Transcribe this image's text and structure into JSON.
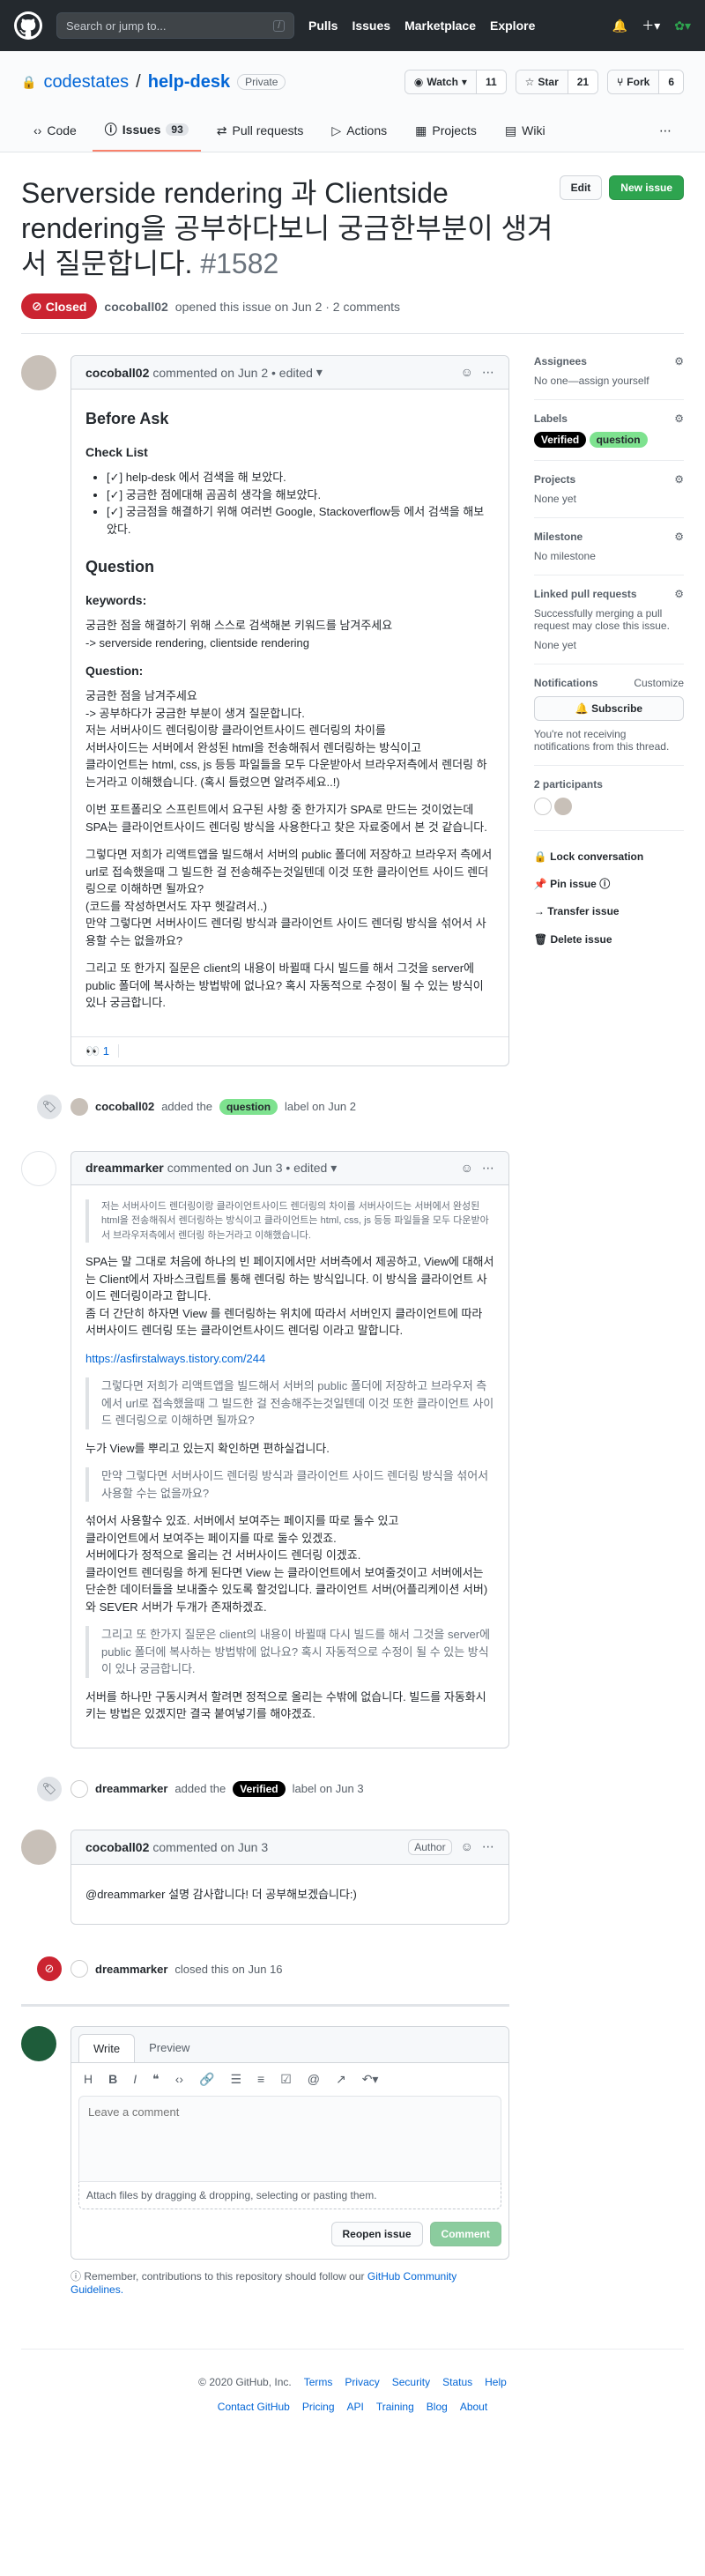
{
  "header": {
    "search_placeholder": "Search or jump to...",
    "slash": "/",
    "nav": [
      "Pulls",
      "Issues",
      "Marketplace",
      "Explore"
    ]
  },
  "repo": {
    "owner": "codestates",
    "name": "help-desk",
    "visibility": "Private",
    "watch": "Watch",
    "watch_count": "11",
    "star": "Star",
    "star_count": "21",
    "fork": "Fork",
    "fork_count": "6"
  },
  "tabs": [
    {
      "label": "Code"
    },
    {
      "label": "Issues",
      "count": "93"
    },
    {
      "label": "Pull requests"
    },
    {
      "label": "Actions"
    },
    {
      "label": "Projects"
    },
    {
      "label": "Wiki"
    }
  ],
  "issue": {
    "title": "Serverside rendering 과 Clientside rendering을 공부하다보니 궁금한부분이 생겨서 질문합니다.",
    "number": "#1582",
    "edit": "Edit",
    "new_issue": "New issue",
    "state": "Closed",
    "author": "cocoball02",
    "meta": "opened this issue on Jun 2 · 2 comments"
  },
  "c1": {
    "author": "cocoball02",
    "meta": "commented on Jun 2 • edited",
    "h_before": "Before Ask",
    "h_check": "Check List",
    "checks": [
      "[✓] help-desk 에서 검색을 해 보았다.",
      "[✓] 궁금한 점에대해 곰곰히 생각을 해보았다.",
      "[✓] 궁금점을 해결하기 위해 여러번 Google, Stackoverflow등 에서 검색을 해보았다."
    ],
    "h_question": "Question",
    "h_keywords": "keywords:",
    "kw": "궁금한 점을 해결하기 위해 스스로 검색해본 키워드를 남겨주세요\n-> serverside rendering, clientside rendering",
    "h_q": "Question:",
    "q1": "궁금한 점을 남겨주세요\n-> 공부하다가 궁금한 부분이 생겨 질문합니다.\n저는 서버사이드 렌더링이랑 클라이언트사이드 렌더링의 차이를\n서버사이드는 서버에서 완성된 html을 전송해줘서 렌더링하는 방식이고\n클라이언트는 html, css, js 등등 파일들을 모두 다운받아서 브라우저측에서 렌더링 하는거라고 이해했습니다. (혹시 틀렸으면 알려주세요..!)",
    "q2": "이번 포트폴리오 스프린트에서 요구된 사항 중 한가지가 SPA로 만드는 것이었는데 SPA는 클라이언트사이드 렌더링 방식을 사용한다고 찾은 자료중에서 본 것 같습니다.",
    "q3": "그렇다면 저희가 리액트앱을 빌드해서 서버의 public 폴더에 저장하고 브라우저 측에서 url로 접속했을때 그 빌드한 걸 전송해주는것일텐데 이것 또한 클라이언트 사이드 렌더링으로 이해하면 될까요?\n(코드를 작성하면서도 자꾸 헷갈려서..)\n만약 그렇다면 서버사이드 렌더링 방식과 클라이언트 사이드 렌더링 방식을 섞어서 사용할 수는 없을까요?",
    "q4": "그리고 또 한가지 질문은 client의 내용이 바뀔때 다시 빌드를 해서 그것을 server에 public 폴더에 복사하는 방법밖에 없나요? 혹시 자동적으로 수정이 될 수 있는 방식이 있나 궁금합니다.",
    "reaction": "👀 1"
  },
  "ev1": {
    "actor": "cocoball02",
    "text": "added the",
    "label": "question",
    "after": "label on Jun 2"
  },
  "c2": {
    "author": "dreammarker",
    "meta": "commented on Jun 3 • edited",
    "quote1": "저는 서버사이드 렌더링이랑 클라이언트사이드 렌더링의 차이를 서버사이드는 서버에서 완성된 html을 전송해줘서 렌더링하는 방식이고 클라이언트는 html, css, js 등등 파일들을 모두 다운받아서 브라우저측에서 렌더링 하는거라고 이해했습니다.",
    "p1": "SPA는 말 그대로 처음에 하나의 빈 페이지에서만 서버측에서 제공하고, View에 대해서는 Client에서 자바스크립트를 통해 렌더링 하는 방식입니다. 이 방식을 클라이언트 사이드 렌더링이라고 합니다.\n좀 더 간단히 하자면 View 를 렌더링하는 위치에 따라서 서버인지 클라이언트에 따라 서버사이드 렌더링 또는 클라이언트사이드 렌더링 이라고 말합니다.",
    "link": "https://asfirstalways.tistory.com/244",
    "quote2": "그렇다면 저희가 리액트앱을 빌드해서 서버의 public 폴더에 저장하고 브라우저 측에서 url로 접속했을때 그 빌드한 걸 전송해주는것일텐데 이것 또한 클라이언트 사이드 렌더링으로 이해하면 될까요?",
    "p2": "누가 View를 뿌리고 있는지 확인하면 편하실겁니다.",
    "quote3": "만약 그렇다면 서버사이드 렌더링 방식과 클라이언트 사이드 렌더링 방식을 섞어서 사용할 수는 없을까요?",
    "p3": "섞어서 사용할수 있죠. 서버에서 보여주는 페이지를 따로 둘수 있고\n클라이언트에서 보여주는 페이지를 따로 둘수 있겠죠.\n서버에다가 정적으로 올리는 건 서버사이드 렌더링 이겠죠.\n클라이언트 렌더링을 하게 된다면 View 는 클라이언트에서 보여줄것이고 서버에서는 단순한 데이터들을 보내줄수 있도록 할것입니다. 클라이언트 서버(어플리케이션 서버)와 SEVER 서버가 두개가 존재하겠죠.",
    "quote4": "그리고 또 한가지 질문은 client의 내용이 바뀔때 다시 빌드를 해서 그것을 server에 public 폴더에 복사하는 방법밖에 없나요? 혹시 자동적으로 수정이 될 수 있는 방식이 있나 궁금합니다.",
    "p4": "서버를 하나만 구동시켜서 할려면 정적으로 올리는 수밖에 없습니다. 빌드를 자동화시키는 방법은 있겠지만 결국 붙여넣기를 해야겠죠."
  },
  "ev2": {
    "actor": "dreammarker",
    "text": "added the",
    "label": "Verified",
    "after": "label on Jun 3"
  },
  "c3": {
    "author": "cocoball02",
    "meta": "commented on Jun 3",
    "role": "Author",
    "body": "@dreammarker 설명 감사합니다! 더 공부해보겠습니다:)"
  },
  "ev3": {
    "actor": "dreammarker",
    "text": "closed this on Jun 16"
  },
  "editor": {
    "write": "Write",
    "preview": "Preview",
    "placeholder": "Leave a comment",
    "attach": "Attach files by dragging & dropping, selecting or pasting them.",
    "reopen": "Reopen issue",
    "comment": "Comment",
    "remember": "Remember, contributions to this repository should follow our",
    "guidelines": "GitHub Community Guidelines."
  },
  "sidebar": {
    "assignees": "Assignees",
    "assignees_v": "No one—assign yourself",
    "labels": "Labels",
    "l1": "Verified",
    "l2": "question",
    "projects": "Projects",
    "projects_v": "None yet",
    "milestone": "Milestone",
    "milestone_v": "No milestone",
    "linked": "Linked pull requests",
    "linked_desc": "Successfully merging a pull request may close this issue.",
    "linked_v": "None yet",
    "notifications": "Notifications",
    "customize": "Customize",
    "subscribe": "Subscribe",
    "notif_desc": "You're not receiving notifications from this thread.",
    "participants": "2 participants",
    "lock": "Lock conversation",
    "pin": "Pin issue",
    "transfer": "Transfer issue",
    "delete": "Delete issue"
  },
  "footer": {
    "copy": "© 2020 GitHub, Inc.",
    "links1": [
      "Terms",
      "Privacy",
      "Security",
      "Status",
      "Help"
    ],
    "links2": [
      "Contact GitHub",
      "Pricing",
      "API",
      "Training",
      "Blog",
      "About"
    ]
  }
}
